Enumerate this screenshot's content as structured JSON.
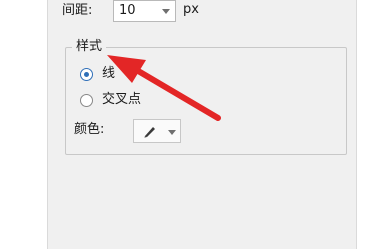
{
  "spacing": {
    "label": "间距:",
    "value": "10",
    "unit": "px"
  },
  "style_group": {
    "title": "样式",
    "options": [
      {
        "label": "线",
        "checked": true
      },
      {
        "label": "交叉点",
        "checked": false
      }
    ]
  },
  "color": {
    "label": "颜色:"
  },
  "icons": {
    "pen": "pen-icon",
    "dropdown": "chevron-down-icon"
  },
  "colors": {
    "annotation_arrow": "#e32626",
    "panel_bg": "#f0f0f0",
    "radio_accent": "#2f6fb8"
  }
}
